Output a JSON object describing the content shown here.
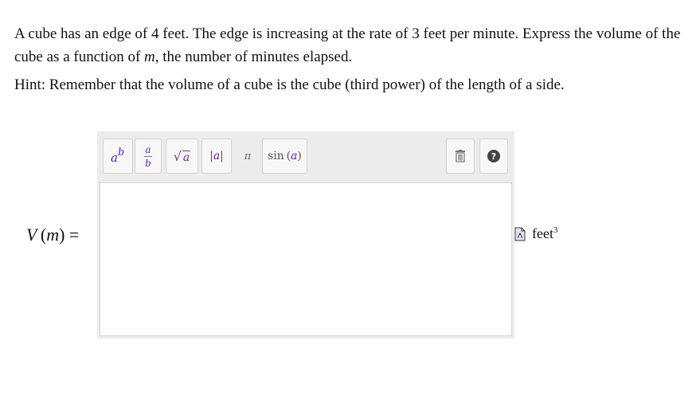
{
  "problem": {
    "line1_pre": "A cube has an edge of 4 feet. The edge is increasing at the rate of 3 feet per minute. Express the volume of the cube as a function of ",
    "variable": "m",
    "line1_post": ", the number of minutes elapsed.",
    "hint": "Hint: Remember that the volume of a cube is the cube (third power) of the length of a side."
  },
  "answer": {
    "func_name": "V",
    "func_arg": "m",
    "equals": "=",
    "value": "",
    "unit": "feet",
    "unit_exponent": "3"
  },
  "toolbar": {
    "power_base": "a",
    "power_exp": "b",
    "frac_num": "a",
    "frac_den": "b",
    "sqrt_arg": "a",
    "abs_arg": "a",
    "pi": "π",
    "sin_label": "sin",
    "sin_arg": "a",
    "help": "?"
  },
  "icons": {
    "trash": "trash-icon",
    "help": "help-icon",
    "unit_picker": "unit-picker-icon"
  }
}
